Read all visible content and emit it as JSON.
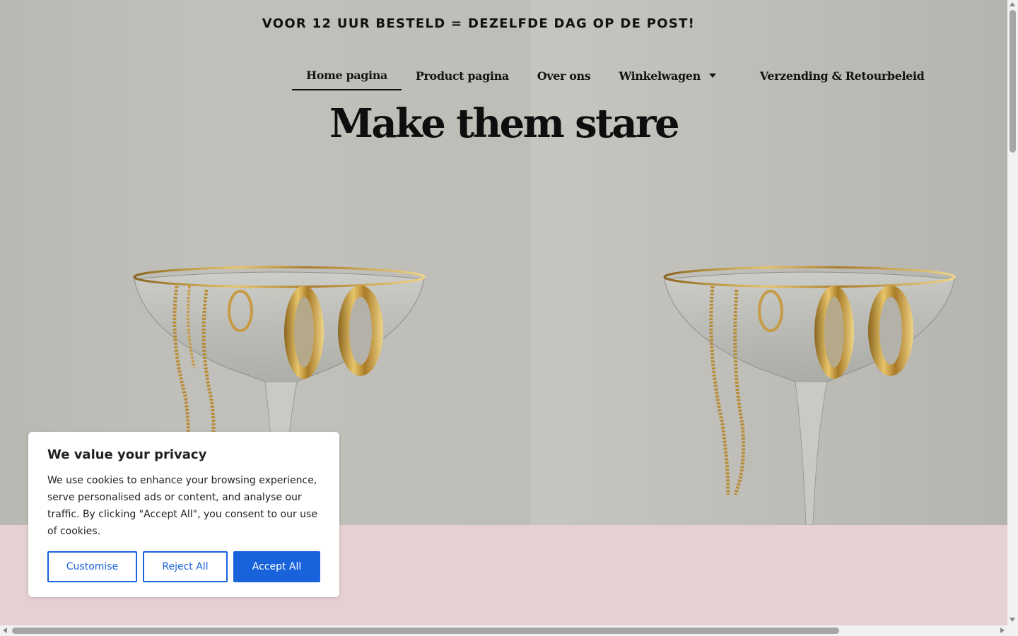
{
  "announcement": "VOOR 12 UUR BESTELD = DEZELFDE DAG OP DE POST!",
  "nav": {
    "items": [
      {
        "label": "Home pagina",
        "active": true
      },
      {
        "label": "Product pagina"
      },
      {
        "label": "Over ons"
      },
      {
        "label": "Winkelwagen",
        "has_dropdown": true
      },
      {
        "label": "Verzending & Retourbeleid"
      }
    ]
  },
  "hero": {
    "title": "Make them stare",
    "images": [
      {
        "icon": "jewelry-glass-photo"
      },
      {
        "icon": "jewelry-glass-photo"
      }
    ]
  },
  "cookie_banner": {
    "title": "We value your privacy",
    "text": "We use cookies to enhance your browsing experience, serve personalised ads or content, and analyse our traffic. By clicking \"Accept All\", you consent to our use of cookies.",
    "buttons": {
      "customise": "Customise",
      "reject": "Reject All",
      "accept": "Accept All"
    }
  },
  "colors": {
    "accent": "#1863dc",
    "pink_band": "#e5d0d3",
    "text": "#111111"
  }
}
